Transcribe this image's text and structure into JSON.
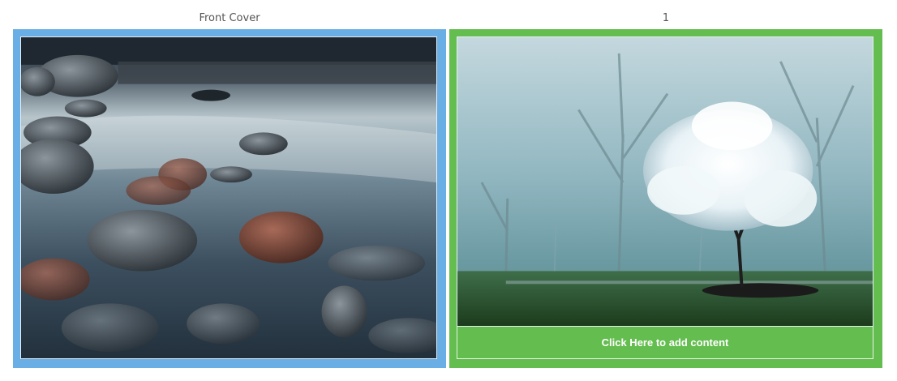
{
  "pages": [
    {
      "label": "Front Cover",
      "accent": "#6aaee6",
      "image": "river-rocks-photo"
    },
    {
      "label": "1",
      "accent": "#63bd4f",
      "image": "white-tree-fog-photo",
      "cta_label": "Click Here to add content"
    }
  ]
}
